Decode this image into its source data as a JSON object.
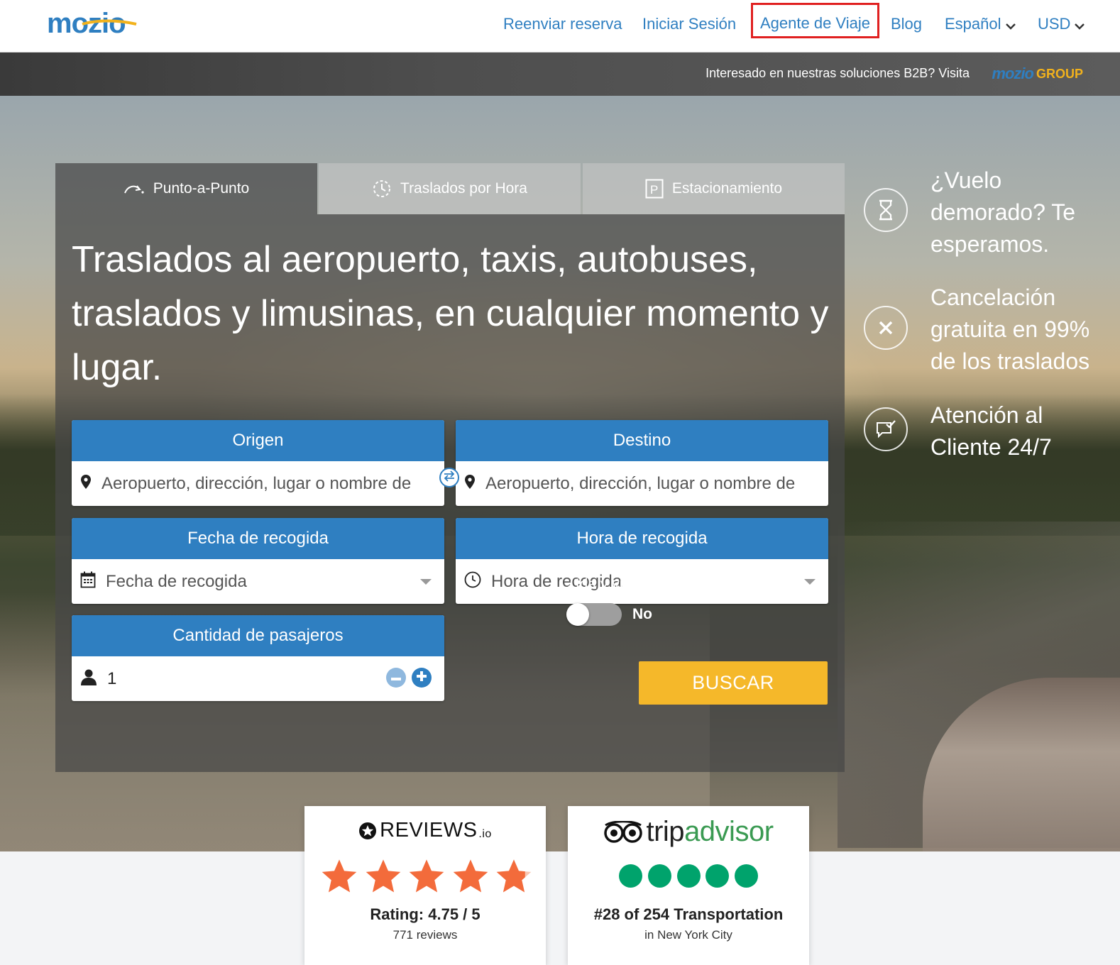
{
  "header": {
    "logo_text": "mozio",
    "nav": [
      {
        "label": "Reenviar reserva"
      },
      {
        "label": "Iniciar Sesión"
      },
      {
        "label": "Agente de Viaje"
      },
      {
        "label": "Blog"
      },
      {
        "label": "Español"
      },
      {
        "label": "USD"
      }
    ]
  },
  "b2b": {
    "text": "Interesado en nuestras soluciones B2B? Visita",
    "logo_mozio": "mozio",
    "logo_group": "GROUP"
  },
  "booking": {
    "tabs": [
      {
        "label": "Punto-a-Punto",
        "icon": "curved-arrow-icon",
        "active": true
      },
      {
        "label": "Traslados por Hora",
        "icon": "clock-dashed-icon",
        "active": false
      },
      {
        "label": "Estacionamiento",
        "icon": "parking-icon",
        "active": false
      }
    ],
    "headline": "Traslados al aeropuerto, taxis, autobuses, traslados y limusinas, en cualquier momento y lugar.",
    "origin": {
      "label": "Origen",
      "placeholder": "Aeropuerto, dirección, lugar o nombre de"
    },
    "destination": {
      "label": "Destino",
      "placeholder": "Aeropuerto, dirección, lugar o nombre de"
    },
    "pickup_date": {
      "label": "Fecha de recogida",
      "placeholder": "Fecha de recogida"
    },
    "pickup_time": {
      "label": "Hora de recogida",
      "placeholder": "Hora de recogida"
    },
    "passengers": {
      "label": "Cantidad de pasajeros",
      "value": "1"
    },
    "round_trip": {
      "label": "¿Ida y vuelta?",
      "state": "No"
    },
    "search_label": "BUSCAR"
  },
  "features": [
    {
      "text": "¿Vuelo demorado? Te esperamos.",
      "icon": "hourglass-icon"
    },
    {
      "text": "Cancelación gratuita en 99% de los traslados",
      "icon": "cancel-x-icon"
    },
    {
      "text": "Atención al Cliente 24/7",
      "icon": "support-chat-icon"
    }
  ],
  "reviews_io": {
    "brand": "REVIEWS",
    "brand_suffix": ".io",
    "rating_text": "Rating: 4.75 / 5",
    "count_text": "771 reviews",
    "rating": 4.75,
    "max": 5
  },
  "tripadvisor": {
    "brand_a": "trip",
    "brand_b": "advisor",
    "rank_text": "#28 of 254 Transportation",
    "location_text": "in New York City",
    "bubbles": 5
  },
  "colors": {
    "primary_blue": "#2f7fc1",
    "cta_yellow": "#f5b82a",
    "star_orange": "#f36b3b",
    "tripadvisor_green": "#00a36c",
    "highlight_red": "#e02020"
  }
}
